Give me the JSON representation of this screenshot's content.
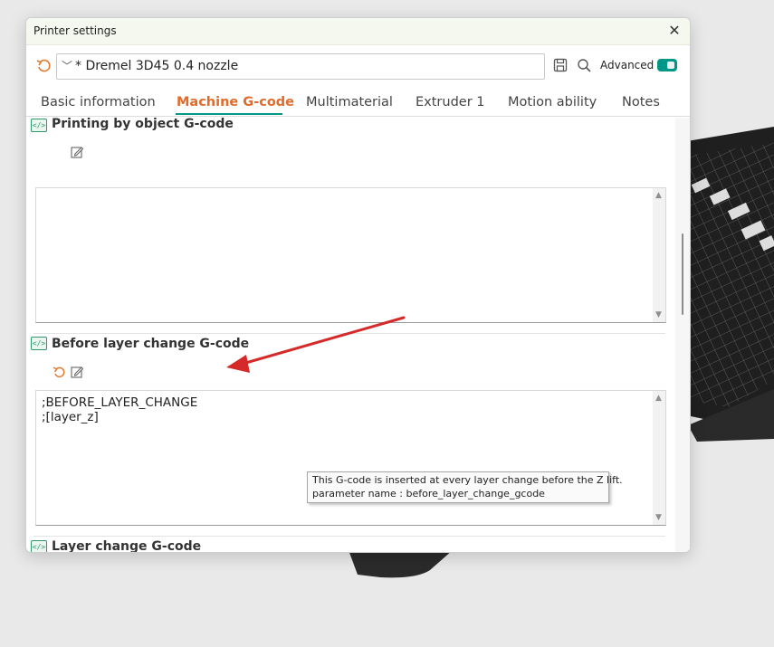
{
  "window": {
    "title": "Printer settings"
  },
  "preset": {
    "name": "* Dremel 3D45 0.4 nozzle",
    "advanced_label": "Advanced",
    "advanced_on": true
  },
  "tabs": [
    {
      "label": "Basic information",
      "active": false
    },
    {
      "label": "Machine G-code",
      "active": true
    },
    {
      "label": "Multimaterial",
      "active": false
    },
    {
      "label": "Extruder 1",
      "active": false
    },
    {
      "label": "Motion ability",
      "active": false
    },
    {
      "label": "Notes",
      "active": false
    }
  ],
  "sections": [
    {
      "title": "Printing by object G-code",
      "content": ""
    },
    {
      "title": "Before layer change G-code",
      "content": ";BEFORE_LAYER_CHANGE\n;[layer_z]"
    },
    {
      "title": "Layer change G-code"
    }
  ],
  "tooltip": {
    "line1": "This G-code is inserted at every layer change before the Z lift.",
    "line2": "parameter name    : before_layer_change_gcode"
  },
  "colors": {
    "accent": "#009688",
    "active_tab": "#e06b2c",
    "arrow": "#d62a2a"
  }
}
